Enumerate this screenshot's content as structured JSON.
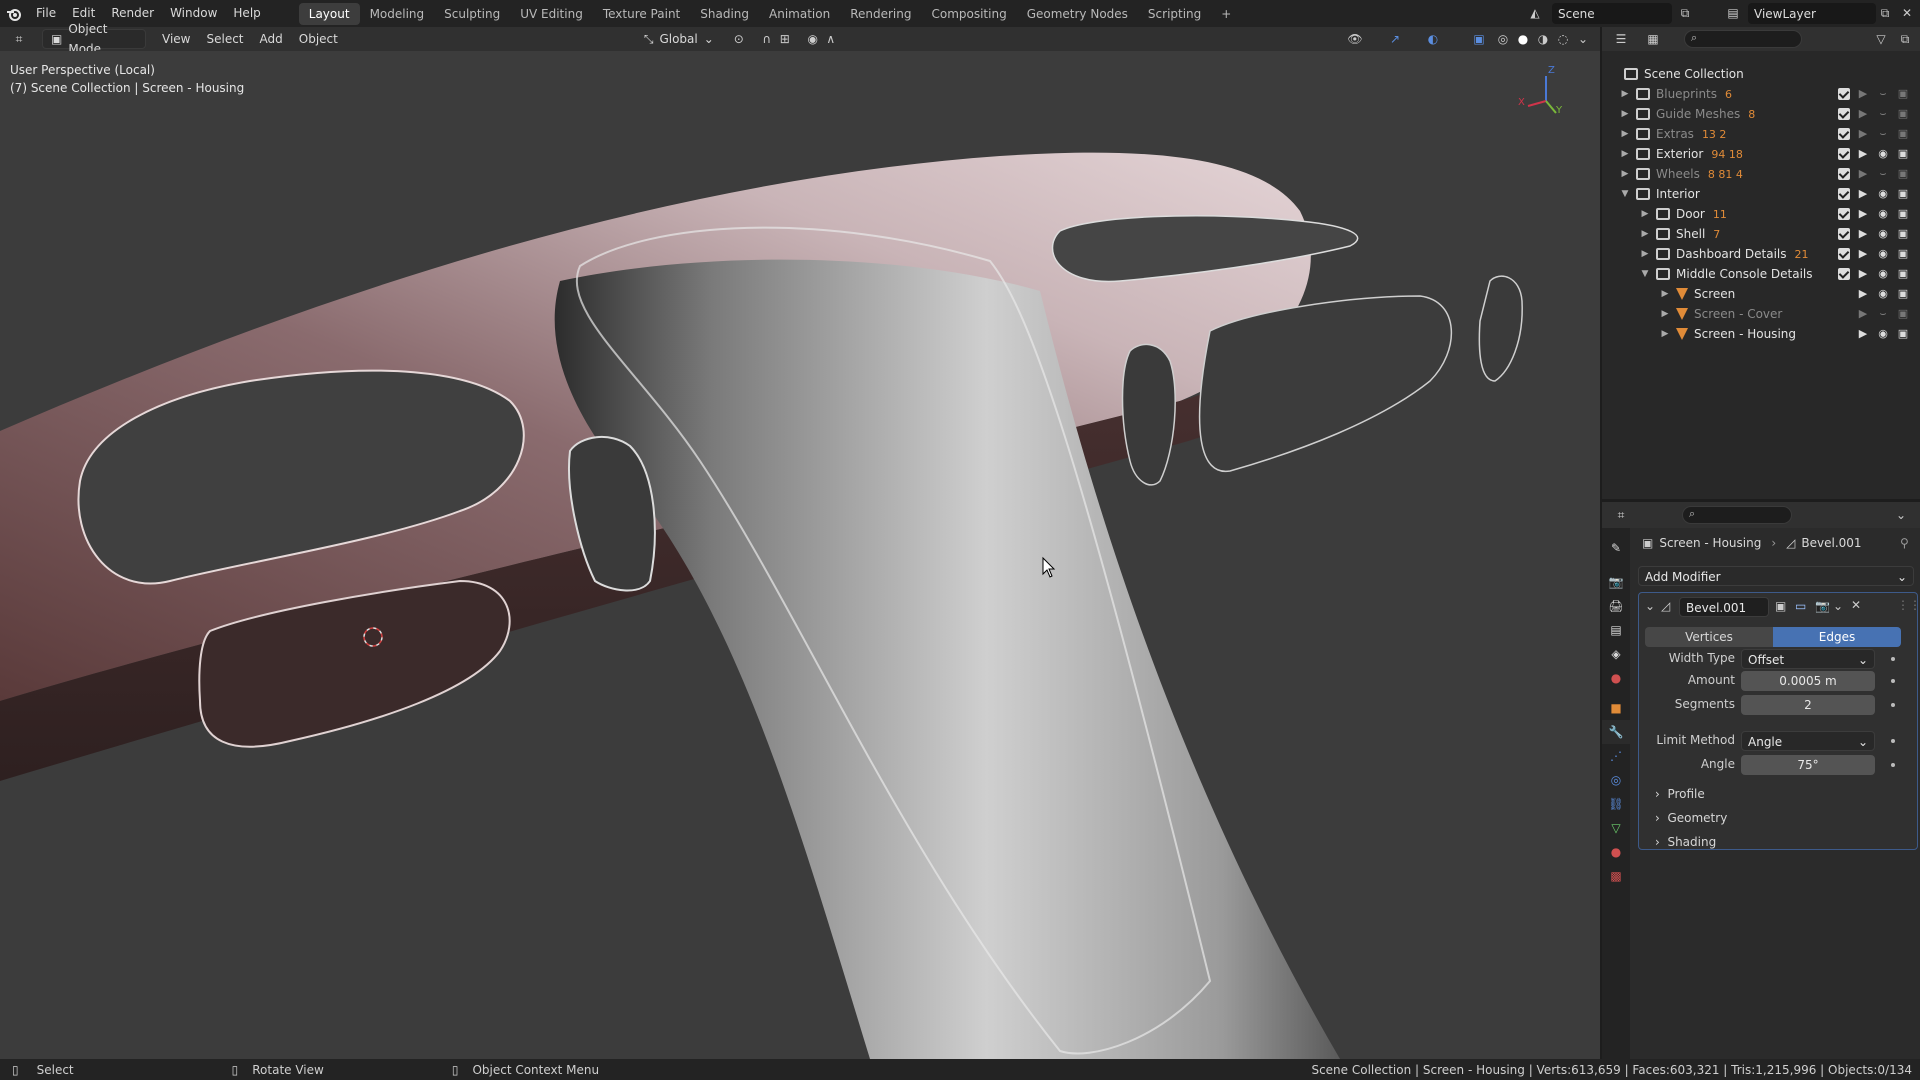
{
  "topbar": {
    "menus": [
      "File",
      "Edit",
      "Render",
      "Window",
      "Help"
    ],
    "workspaces": [
      "Layout",
      "Modeling",
      "Sculpting",
      "UV Editing",
      "Texture Paint",
      "Shading",
      "Animation",
      "Rendering",
      "Compositing",
      "Geometry Nodes",
      "Scripting"
    ],
    "active_workspace": "Layout",
    "add_tab": "+",
    "scene": "Scene",
    "view_layer": "ViewLayer"
  },
  "viewport_header": {
    "mode": "Object Mode",
    "menus": [
      "View",
      "Select",
      "Add",
      "Object"
    ],
    "orientation": "Global"
  },
  "viewport": {
    "perspective": "User Perspective (Local)",
    "context": "(7) Scene Collection | Screen - Housing",
    "gizmo_axes": [
      "Z",
      "X",
      "Y"
    ]
  },
  "outliner": {
    "root": "Scene Collection",
    "rows": [
      {
        "label": "Blueprints",
        "badge": "6",
        "dim": true,
        "expanded": false,
        "depth": 0,
        "type": "collection"
      },
      {
        "label": "Guide Meshes",
        "badge": "8",
        "dim": true,
        "expanded": false,
        "depth": 0,
        "type": "collection"
      },
      {
        "label": "Extras",
        "badge": "13  2",
        "dim": true,
        "expanded": false,
        "depth": 0,
        "type": "collection"
      },
      {
        "label": "Exterior",
        "badge": "94 18",
        "dim": false,
        "expanded": false,
        "depth": 0,
        "type": "collection"
      },
      {
        "label": "Wheels",
        "badge": "8 81 4",
        "dim": true,
        "expanded": false,
        "depth": 0,
        "type": "collection"
      },
      {
        "label": "Interior",
        "badge": "",
        "dim": false,
        "expanded": true,
        "depth": 0,
        "type": "collection"
      },
      {
        "label": "Door",
        "badge": "11",
        "dim": false,
        "expanded": false,
        "depth": 1,
        "type": "collection"
      },
      {
        "label": "Shell",
        "badge": "7",
        "dim": false,
        "expanded": false,
        "depth": 1,
        "type": "collection"
      },
      {
        "label": "Dashboard Details",
        "badge": "21",
        "dim": false,
        "expanded": false,
        "depth": 1,
        "type": "collection"
      },
      {
        "label": "Middle Console Details",
        "badge": "",
        "dim": false,
        "expanded": true,
        "depth": 1,
        "type": "collection"
      },
      {
        "label": "Screen",
        "badge": "",
        "dim": false,
        "expanded": false,
        "depth": 2,
        "type": "mesh"
      },
      {
        "label": "Screen - Cover",
        "badge": "",
        "dim": true,
        "expanded": false,
        "depth": 2,
        "type": "mesh"
      },
      {
        "label": "Screen - Housing",
        "badge": "",
        "dim": false,
        "expanded": false,
        "depth": 2,
        "type": "mesh"
      }
    ]
  },
  "properties": {
    "breadcrumb_object": "Screen - Housing",
    "breadcrumb_modifier": "Bevel.001",
    "add_modifier": "Add Modifier",
    "modifier_name": "Bevel.001",
    "affect_tabs": [
      "Vertices",
      "Edges"
    ],
    "affect_active": "Edges",
    "width_type_label": "Width Type",
    "width_type_value": "Offset",
    "amount_label": "Amount",
    "amount_value": "0.0005 m",
    "segments_label": "Segments",
    "segments_value": "2",
    "limit_method_label": "Limit Method",
    "limit_method_value": "Angle",
    "angle_label": "Angle",
    "angle_value": "75°",
    "subpanels": [
      "Profile",
      "Geometry",
      "Shading"
    ]
  },
  "statusbar": {
    "select": "Select",
    "rotate": "Rotate View",
    "context_menu": "Object Context Menu",
    "stats": "Scene Collection | Screen - Housing | Verts:613,659 | Faces:603,321 | Tris:1,215,996 | Objects:0/134"
  },
  "colors": {
    "accent": "#4772b3",
    "object_orange": "#e08b38",
    "mesh_green": "#6ccf6c"
  }
}
